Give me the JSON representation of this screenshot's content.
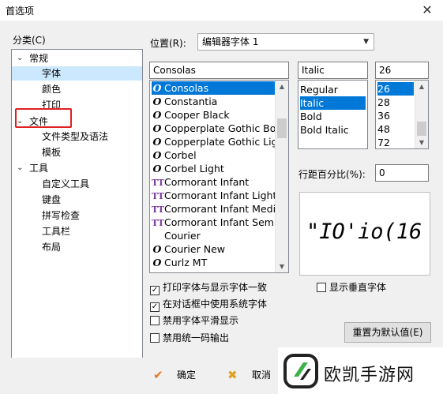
{
  "window": {
    "title": "首选项",
    "close_glyph": "✕"
  },
  "category": {
    "label": "分类(C)",
    "items": [
      {
        "label": "常规",
        "chevron": "⌄"
      },
      {
        "label": "字体"
      },
      {
        "label": "颜色"
      },
      {
        "label": "打印"
      },
      {
        "label": "文件",
        "chevron": "⌄"
      },
      {
        "label": "文件类型及语法"
      },
      {
        "label": "模板"
      },
      {
        "label": "工具",
        "chevron": "⌄"
      },
      {
        "label": "自定义工具"
      },
      {
        "label": "键盘"
      },
      {
        "label": "拼写检查"
      },
      {
        "label": "工具栏"
      },
      {
        "label": "布局"
      }
    ]
  },
  "position": {
    "label": "位置(R):",
    "value": "编辑器字体 1"
  },
  "font": {
    "name_value": "Consolas",
    "style_value": "Italic",
    "size_value": "26",
    "names": [
      {
        "label": "Consolas",
        "icon": "O"
      },
      {
        "label": "Constantia",
        "icon": "O"
      },
      {
        "label": "Cooper Black",
        "icon": "O"
      },
      {
        "label": "Copperplate Gothic Bold",
        "icon": "O"
      },
      {
        "label": "Copperplate Gothic Light",
        "icon": "O"
      },
      {
        "label": "Corbel",
        "icon": "O"
      },
      {
        "label": "Corbel Light",
        "icon": "O"
      },
      {
        "label": "Cormorant Infant",
        "icon": "TT"
      },
      {
        "label": "Cormorant Infant Light",
        "icon": "TT"
      },
      {
        "label": "Cormorant Infant Medium",
        "icon": "TT"
      },
      {
        "label": "Cormorant Infant SemiBold",
        "icon": "TT"
      },
      {
        "label": "Courier",
        "icon": ""
      },
      {
        "label": "Courier New",
        "icon": "O"
      },
      {
        "label": "Curlz MT",
        "icon": "O"
      }
    ],
    "styles": [
      "Regular",
      "Italic",
      "Bold",
      "Bold Italic"
    ],
    "sizes": [
      "26",
      "28",
      "36",
      "48",
      "72"
    ]
  },
  "line_spacing": {
    "label": "行距百分比(%):",
    "value": "0"
  },
  "preview": {
    "text": "\"IO'io(16"
  },
  "options": [
    {
      "label": "打印字体与显示字体一致",
      "checked": true
    },
    {
      "label": "在对话框中使用系统字体",
      "checked": true
    },
    {
      "label": "禁用字体平滑显示",
      "checked": false
    },
    {
      "label": "禁用统一码输出",
      "checked": false
    }
  ],
  "show_vertical": {
    "label": "显示垂直字体",
    "checked": false
  },
  "reset_button": {
    "label": "重置为默认值(E)"
  },
  "ok_button": {
    "label": "确定",
    "icon": "✔"
  },
  "cancel_button": {
    "label": "取消",
    "icon": "✖"
  },
  "watermark": {
    "text": "欧凯手游网"
  }
}
